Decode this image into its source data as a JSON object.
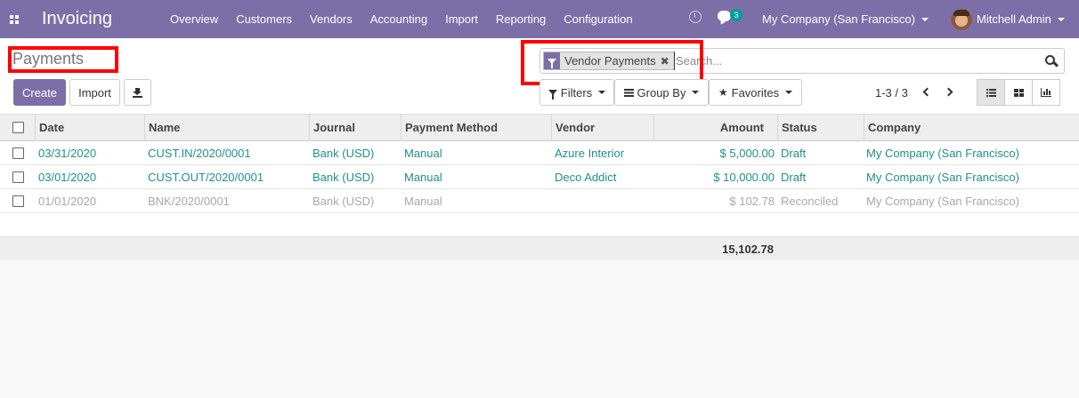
{
  "navbar": {
    "app_name": "Invoicing",
    "menu": [
      "Overview",
      "Customers",
      "Vendors",
      "Accounting",
      "Import",
      "Reporting",
      "Configuration"
    ],
    "chat_count": "3",
    "company": "My Company (San Francisco)",
    "user": "Mitchell Admin"
  },
  "control_panel": {
    "title": "Payments",
    "create_label": "Create",
    "import_label": "Import",
    "facet_label": "Vendor Payments",
    "facet_close": "✖",
    "search_placeholder": "Search...",
    "filters_label": "Filters",
    "groupby_label": "Group By",
    "favorites_label": "Favorites",
    "pager": "1-3 / 3"
  },
  "table": {
    "columns": [
      "Date",
      "Name",
      "Journal",
      "Payment Method",
      "Vendor",
      "Amount",
      "Status",
      "Company"
    ],
    "rows": [
      {
        "date": "03/31/2020",
        "name": "CUST.IN/2020/0001",
        "journal": "Bank (USD)",
        "method": "Manual",
        "vendor": "Azure Interior",
        "amount": "$ 5,000.00",
        "status": "Draft",
        "company": "My Company (San Francisco)"
      },
      {
        "date": "03/01/2020",
        "name": "CUST.OUT/2020/0001",
        "journal": "Bank (USD)",
        "method": "Manual",
        "vendor": "Deco Addict",
        "amount": "$ 10,000.00",
        "status": "Draft",
        "company": "My Company (San Francisco)"
      },
      {
        "date": "01/01/2020",
        "name": "BNK/2020/0001",
        "journal": "Bank (USD)",
        "method": "Manual",
        "vendor": "",
        "amount": "$ 102.78",
        "status": "Reconciled",
        "company": "My Company (San Francisco)"
      }
    ],
    "total": "15,102.78"
  },
  "colors": {
    "brand": "#7c6fa8",
    "link": "#1f8f8d",
    "highlight": "#ff0000"
  }
}
